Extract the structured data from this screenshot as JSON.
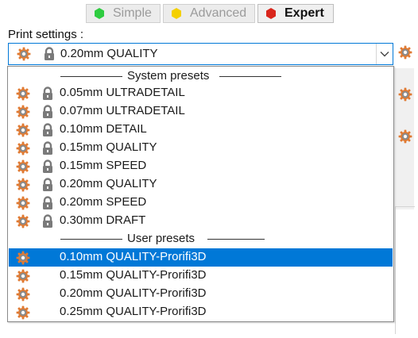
{
  "mode_tabs": [
    {
      "label": "Simple",
      "dot_color": "#2ecc40",
      "state": "inactive"
    },
    {
      "label": "Advanced",
      "dot_color": "#f4d000",
      "state": "inactive"
    },
    {
      "label": "Expert",
      "dot_color": "#d9261c",
      "state": "active"
    }
  ],
  "print_settings": {
    "label": "Print settings :",
    "selected": "0.20mm QUALITY"
  },
  "dropdown": {
    "system_header": "System presets",
    "system_presets": [
      "0.05mm ULTRADETAIL",
      "0.07mm ULTRADETAIL",
      "0.10mm DETAIL",
      "0.15mm QUALITY",
      "0.15mm SPEED",
      "0.20mm QUALITY",
      "0.20mm SPEED",
      "0.30mm DRAFT"
    ],
    "user_header": "User presets",
    "user_presets": [
      "0.10mm QUALITY-Prorifi3D",
      "0.15mm QUALITY-Prorifi3D",
      "0.20mm QUALITY-Prorifi3D",
      "0.25mm QUALITY-Prorifi3D"
    ],
    "selected_user_index": 0
  },
  "colors": {
    "accent": "#0078d7",
    "gear_outer": "#e07a32",
    "gear_inner": "#8a8a8a",
    "lock": "#7a7a7a"
  }
}
